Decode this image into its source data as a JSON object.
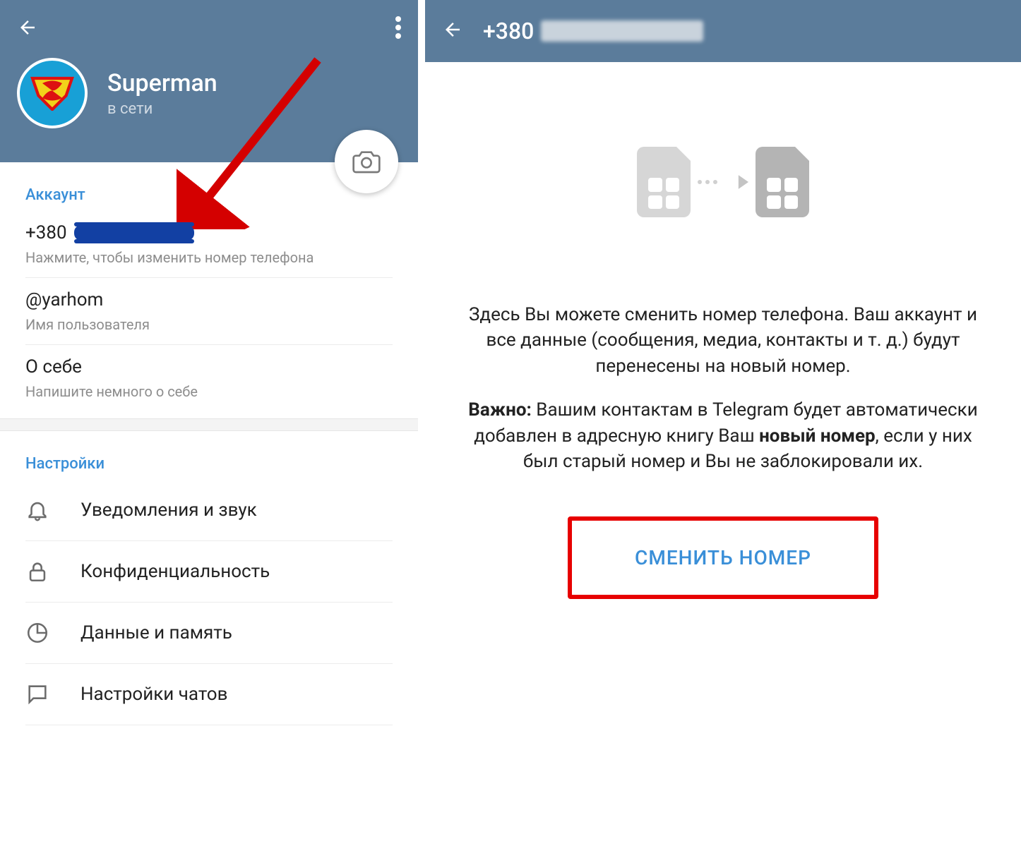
{
  "left": {
    "profile": {
      "display_name": "Superman",
      "status": "в сети"
    },
    "account": {
      "section_title": "Аккаунт",
      "phone_prefix": "+380",
      "phone_hint": "Нажмите, чтобы изменить номер телефона",
      "username": "@yarhom",
      "username_hint": "Имя пользователя",
      "about_title": "О себе",
      "about_hint": "Напишите немного о себе"
    },
    "settings": {
      "section_title": "Настройки",
      "items": [
        {
          "label": "Уведомления и звук",
          "icon": "bell-icon"
        },
        {
          "label": "Конфиденциальность",
          "icon": "lock-icon"
        },
        {
          "label": "Данные и память",
          "icon": "pie-chart-icon"
        },
        {
          "label": "Настройки чатов",
          "icon": "chat-icon"
        }
      ]
    }
  },
  "right": {
    "header_prefix": "+380",
    "desc1": "Здесь Вы можете сменить номер телефона. Ваш аккаунт и все данные (сообщения, медиа, контакты и т. д.) будут перенесены на новый номер.",
    "important_label": "Важно:",
    "desc2_a": " Вашим контактам в Telegram будет автоматически добавлен в адресную книгу Ваш ",
    "desc2_bold": "новый номер",
    "desc2_b": ", если у них был старый номер и Вы не заблокировали их.",
    "button_label": "СМЕНИТЬ НОМЕР"
  }
}
